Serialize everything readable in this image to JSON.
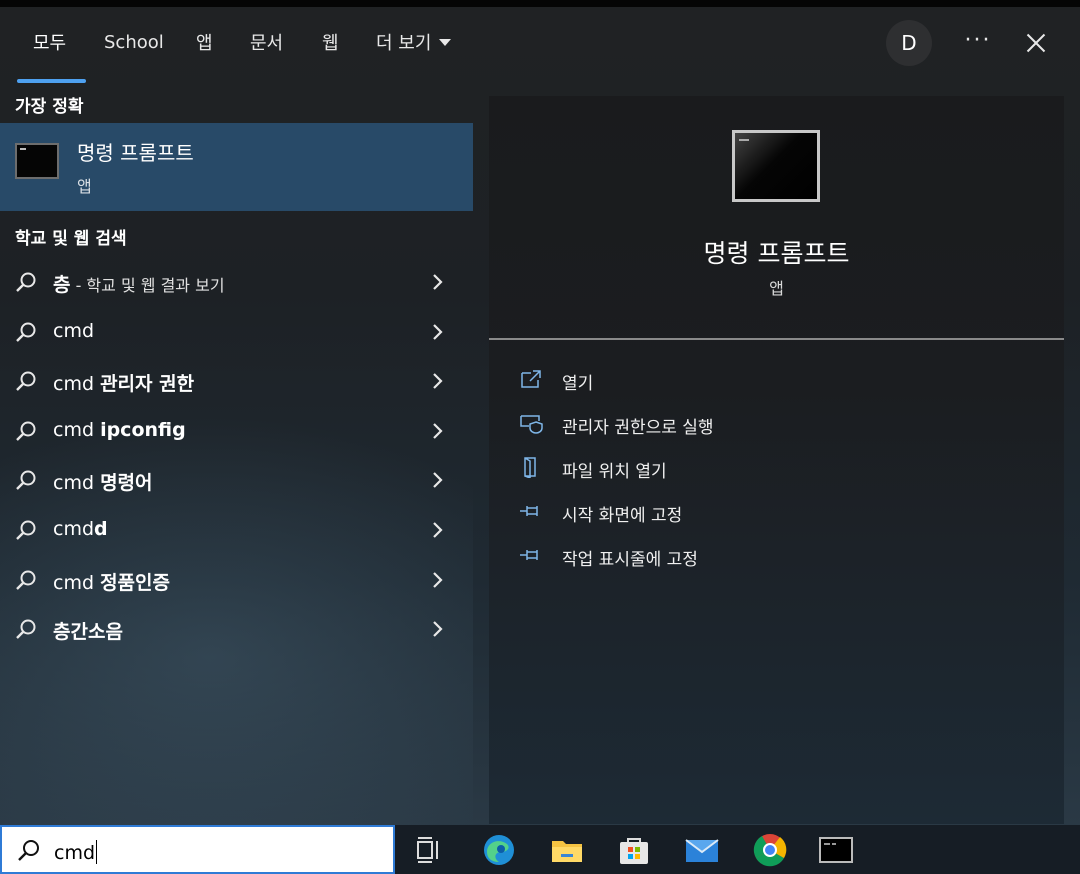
{
  "tabs": [
    {
      "label": "모두",
      "active": true
    },
    {
      "label": "School",
      "active": false
    },
    {
      "label": "앱",
      "active": false
    },
    {
      "label": "문서",
      "active": false
    },
    {
      "label": "웹",
      "active": false
    },
    {
      "label": "더 보기",
      "active": false
    }
  ],
  "header": {
    "avatar_initial": "D",
    "more_label": "···"
  },
  "best_match": {
    "section_label": "가장 정확",
    "title": "명령 프롬프트",
    "subtitle": "앱"
  },
  "web_section_label": "학교 및 웹 검색",
  "results": [
    {
      "prefix": "",
      "bold": "층",
      "suffix": " - 학교 및 웹 결과 보기"
    },
    {
      "prefix": "cmd",
      "bold": "",
      "suffix": ""
    },
    {
      "prefix": "cmd ",
      "bold": "관리자 권한",
      "suffix": ""
    },
    {
      "prefix": "cmd ",
      "bold": "ipconfig",
      "suffix": ""
    },
    {
      "prefix": "cmd ",
      "bold": "명령어",
      "suffix": ""
    },
    {
      "prefix": "cmd",
      "bold": "d",
      "suffix": ""
    },
    {
      "prefix": "cmd ",
      "bold": "정품인증",
      "suffix": ""
    },
    {
      "prefix": "",
      "bold": "층간소음",
      "suffix": ""
    }
  ],
  "detail": {
    "title": "명령 프롬프트",
    "subtitle": "앱",
    "actions": [
      {
        "icon": "open-icon",
        "label": "열기"
      },
      {
        "icon": "shield-icon",
        "label": "관리자 권한으로 실행"
      },
      {
        "icon": "file-location-icon",
        "label": "파일 위치 열기"
      },
      {
        "icon": "pin-icon",
        "label": "시작 화면에 고정"
      },
      {
        "icon": "pin-icon",
        "label": "작업 표시줄에 고정"
      }
    ]
  },
  "search": {
    "query": "cmd"
  },
  "taskbar": {
    "apps": [
      "task-view-icon",
      "edge-icon",
      "file-explorer-icon",
      "store-icon",
      "mail-icon",
      "chrome-icon",
      "terminal-icon"
    ]
  },
  "colors": {
    "accent": "#4ea1f0",
    "selected_row": "#284a68",
    "search_border": "#2f7bd6"
  }
}
